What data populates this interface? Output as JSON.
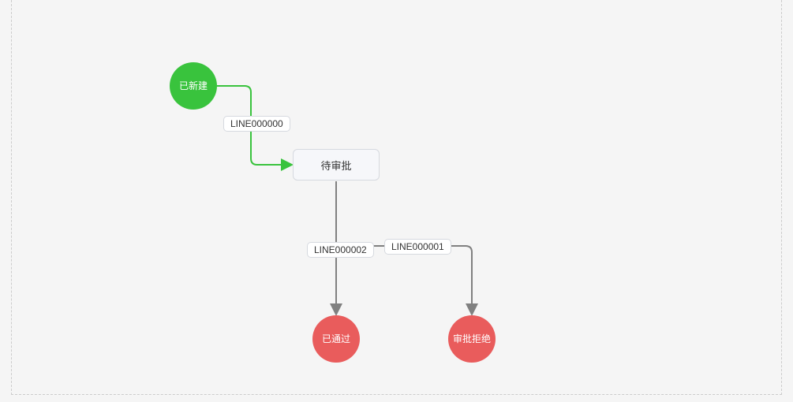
{
  "colors": {
    "start": "#39c33d",
    "end": "#e95c5c",
    "task_bg": "#f6f7fa",
    "task_border": "#d6d9df",
    "edge_default": "#808080",
    "edge_highlight": "#39c33d"
  },
  "nodes": {
    "start": {
      "label": "已新建"
    },
    "pending": {
      "label": "待审批"
    },
    "approved": {
      "label": "已通过"
    },
    "rejected": {
      "label": "审批拒绝"
    }
  },
  "edges": {
    "line0": {
      "label": "LINE000000"
    },
    "line1": {
      "label": "LINE000001"
    },
    "line2": {
      "label": "LINE000002"
    }
  }
}
